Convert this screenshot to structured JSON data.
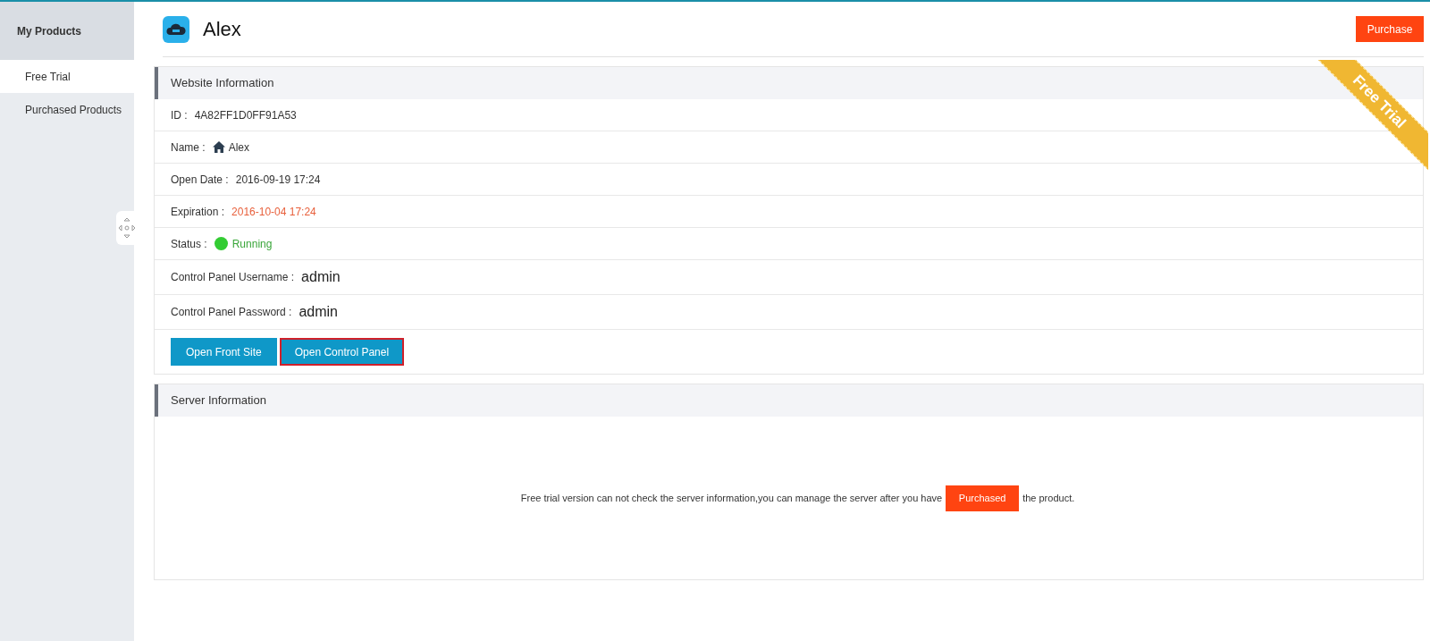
{
  "sidebar": {
    "title": "My Products",
    "items": [
      {
        "label": "Free Trial",
        "selected": true
      },
      {
        "label": "Purchased Products",
        "selected": false
      }
    ]
  },
  "header": {
    "title": "Alex",
    "purchase_button": "Purchase"
  },
  "website_info": {
    "title": "Website Information",
    "ribbon": "Free Trial",
    "rows": [
      {
        "kind": "plain",
        "label": "ID :",
        "value": "4A82FF1D0FF91A53"
      },
      {
        "kind": "home",
        "label": "Name :",
        "value": "Alex"
      },
      {
        "kind": "plain",
        "label": "Open Date :",
        "value": "2016-09-19 17:24"
      },
      {
        "kind": "warning",
        "label": "Expiration :",
        "value": "2016-10-04 17:24"
      },
      {
        "kind": "status",
        "label": "Status :",
        "value": "Running",
        "color": "#33cc33"
      },
      {
        "kind": "credential",
        "label": "Control Panel Username :",
        "value": "admin"
      },
      {
        "kind": "credential",
        "label": "Control Panel Password :",
        "value": "admin"
      }
    ],
    "buttons": [
      {
        "label": "Open Front Site",
        "selected": false
      },
      {
        "label": "Open Control Panel",
        "selected": true
      }
    ]
  },
  "server_info": {
    "title": "Server Information",
    "note_before": "Free trial version can not check the server information,you can manage the server after you have",
    "note_button": "Purchased",
    "note_after": "the product."
  }
}
